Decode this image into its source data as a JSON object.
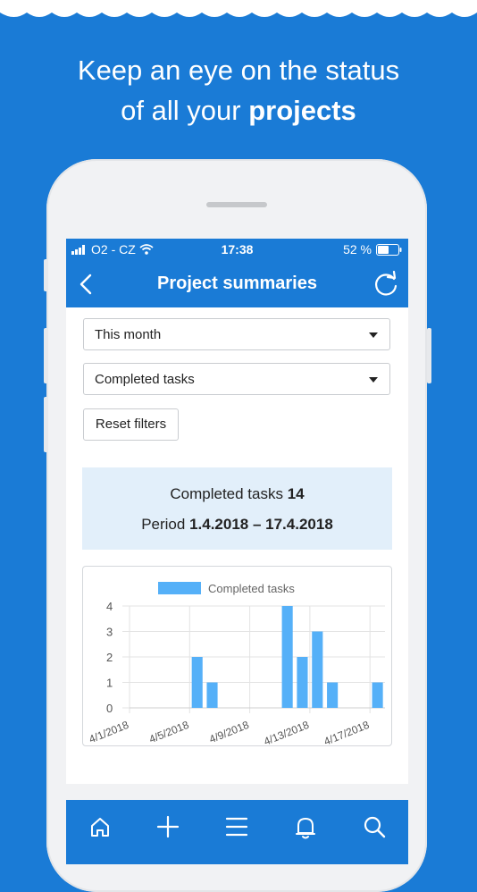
{
  "headline": {
    "line1": "Keep an eye on the status",
    "line2_prefix": "of all your",
    "line2_bold": "projects"
  },
  "statusbar": {
    "carrier": "O2 - CZ",
    "time": "17:38",
    "battery": "52 %"
  },
  "navbar": {
    "title": "Project summaries"
  },
  "filters": {
    "period": "This month",
    "metric": "Completed tasks",
    "reset_label": "Reset filters"
  },
  "summary": {
    "completed_label": "Completed tasks",
    "completed_value": "14",
    "period_label": "Period",
    "period_value": "1.4.2018 – 17.4.2018"
  },
  "chart_data": {
    "type": "bar",
    "legend": [
      "Completed tasks"
    ],
    "x_tick_labels": [
      "4/1/2018",
      "4/5/2018",
      "4/9/2018",
      "4/13/2018",
      "4/17/2018"
    ],
    "ylim": [
      0,
      4
    ],
    "y_ticks": [
      0,
      1,
      2,
      3,
      4
    ],
    "grid": true,
    "legend_position": "top",
    "categories": [
      "4/1/2018",
      "4/2/2018",
      "4/3/2018",
      "4/4/2018",
      "4/5/2018",
      "4/6/2018",
      "4/7/2018",
      "4/8/2018",
      "4/9/2018",
      "4/10/2018",
      "4/11/2018",
      "4/12/2018",
      "4/13/2018",
      "4/14/2018",
      "4/15/2018",
      "4/16/2018",
      "4/17/2018"
    ],
    "series": [
      {
        "name": "Completed tasks",
        "values": [
          0,
          0,
          0,
          0,
          2,
          1,
          0,
          0,
          0,
          0,
          4,
          2,
          3,
          1,
          0,
          0,
          1
        ]
      }
    ],
    "bar_color": "#55b0f8"
  },
  "tabbar": {
    "icons": [
      "home-icon",
      "plus-icon",
      "menu-icon",
      "bell-icon",
      "search-icon"
    ]
  },
  "colors": {
    "brand": "#1a7bd6",
    "summary_bg": "#e2effa"
  }
}
